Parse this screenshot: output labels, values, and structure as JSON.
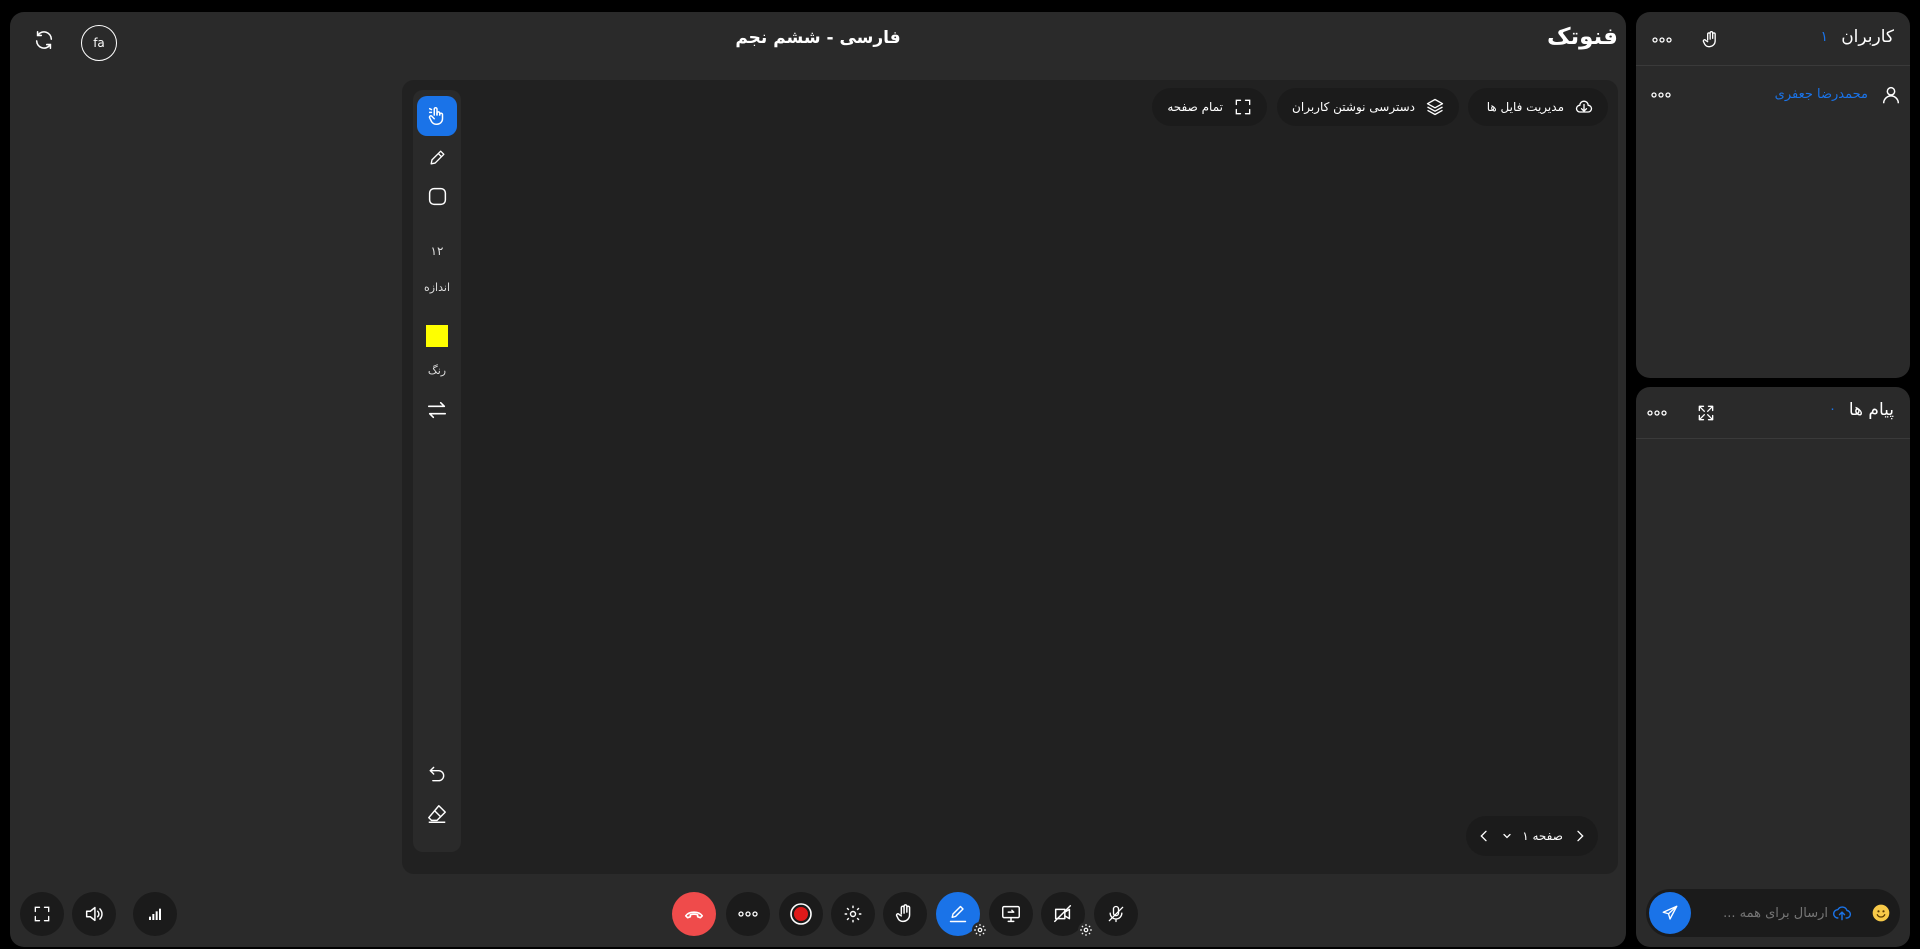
{
  "app": {
    "title": "فارسی - ششم نجم",
    "brand": "فنوتک",
    "language_badge": "fa"
  },
  "toolbar_top": {
    "file_manager": "مدیریت فایل ها",
    "user_write_access": "دسترسی نوشتن کاربران",
    "fullscreen": "تمام صفحه"
  },
  "side_tools": {
    "size_value": "۱۲",
    "size_label": "اندازه",
    "color_label": "رنگ",
    "color_value": "#ffff00"
  },
  "pager": {
    "label": "صفحه ۱"
  },
  "users_panel": {
    "title": "کاربران",
    "count": "۱",
    "users": [
      {
        "name": "محمدرضا جعفری"
      }
    ]
  },
  "messages_panel": {
    "title": "پیام ها",
    "count": "۰",
    "input_placeholder": "ارسال برای همه ..."
  },
  "colors": {
    "accent": "#1a73e8",
    "hangup": "#ef4b4b",
    "record": "#e01919",
    "panel": "#2a2a2a",
    "dark": "#1b1b1b"
  },
  "icons": {
    "refresh": "refresh-icon",
    "cursor": "hand-pointer-icon",
    "pen": "pencil-icon",
    "shape": "square-icon",
    "swap": "swap-arrows-icon",
    "undo": "undo-icon",
    "eraser": "eraser-icon",
    "hand": "hand-raise-icon",
    "expand": "expand-icon",
    "send": "send-icon",
    "emoji": "emoji-icon",
    "upload": "upload-icon"
  }
}
